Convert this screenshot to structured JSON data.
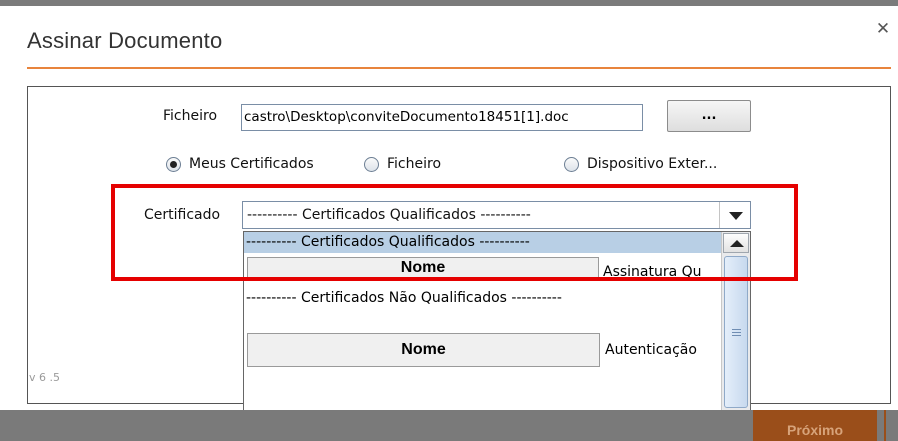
{
  "dialog": {
    "title": "Assinar Documento",
    "version": "v 6 .5"
  },
  "file": {
    "label": "Ficheiro",
    "value": "castro\\Desktop\\conviteDocumento18451[1].doc",
    "browse_label": "..."
  },
  "source_options": [
    {
      "label": "Meus Certificados",
      "selected": true
    },
    {
      "label": "Ficheiro",
      "selected": false
    },
    {
      "label": "Dispositivo Exter...",
      "selected": false
    }
  ],
  "certificate": {
    "label": "Certificado",
    "selected_value": "---------- Certificados Qualificados ----------"
  },
  "dropdown": {
    "items": [
      {
        "type": "group-header",
        "text": "---------- Certificados Qualificados ----------",
        "highlighted": true
      },
      {
        "type": "cert",
        "name": "Nome",
        "usage": "Assinatura Qu"
      },
      {
        "type": "group-header",
        "text": "---------- Certificados Não Qualificados ----------",
        "highlighted": false
      },
      {
        "type": "cert",
        "name": "Nome",
        "usage": "Autenticação"
      }
    ]
  },
  "footer": {
    "next_label": "Próximo"
  },
  "colors": {
    "accent": "#e8843c",
    "highlight_border": "#e50000",
    "dropdown_selected": "#b8cfe5",
    "footer_bg": "#7a7a7a",
    "next_button_bg": "#9a4e1a"
  }
}
